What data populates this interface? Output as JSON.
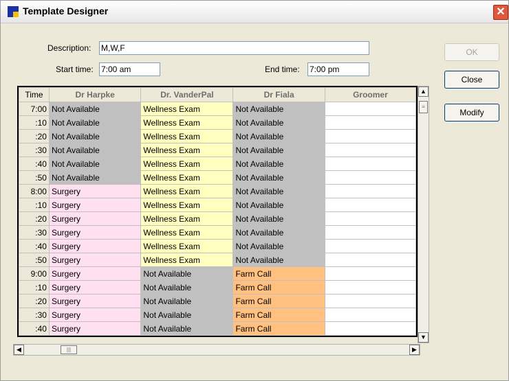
{
  "window": {
    "title": "Template Designer"
  },
  "form": {
    "description_label": "Description:",
    "description_value": "M,W,F",
    "start_label": "Start time:",
    "start_value": "7:00 am",
    "end_label": "End time:",
    "end_value": "7:00 pm"
  },
  "buttons": {
    "ok": "OK",
    "close": "Close",
    "modify": "Modify"
  },
  "grid": {
    "headers": [
      "Time",
      "Dr Harpke",
      "Dr. VanderPal",
      "Dr Fiala",
      "Groomer"
    ],
    "rows": [
      {
        "time": "7:00",
        "harpke": "Not Available",
        "vanderpal": "Wellness Exam",
        "fiala": "Not Available",
        "groomer": ""
      },
      {
        "time": ":10",
        "harpke": "Not Available",
        "vanderpal": "Wellness Exam",
        "fiala": "Not Available",
        "groomer": ""
      },
      {
        "time": ":20",
        "harpke": "Not Available",
        "vanderpal": "Wellness Exam",
        "fiala": "Not Available",
        "groomer": ""
      },
      {
        "time": ":30",
        "harpke": "Not Available",
        "vanderpal": "Wellness Exam",
        "fiala": "Not Available",
        "groomer": ""
      },
      {
        "time": ":40",
        "harpke": "Not Available",
        "vanderpal": "Wellness Exam",
        "fiala": "Not Available",
        "groomer": ""
      },
      {
        "time": ":50",
        "harpke": "Not Available",
        "vanderpal": "Wellness Exam",
        "fiala": "Not Available",
        "groomer": ""
      },
      {
        "time": "8:00",
        "harpke": "Surgery",
        "vanderpal": "Wellness Exam",
        "fiala": "Not Available",
        "groomer": ""
      },
      {
        "time": ":10",
        "harpke": "Surgery",
        "vanderpal": "Wellness Exam",
        "fiala": "Not Available",
        "groomer": ""
      },
      {
        "time": ":20",
        "harpke": "Surgery",
        "vanderpal": "Wellness Exam",
        "fiala": "Not Available",
        "groomer": ""
      },
      {
        "time": ":30",
        "harpke": "Surgery",
        "vanderpal": "Wellness Exam",
        "fiala": "Not Available",
        "groomer": ""
      },
      {
        "time": ":40",
        "harpke": "Surgery",
        "vanderpal": "Wellness Exam",
        "fiala": "Not Available",
        "groomer": ""
      },
      {
        "time": ":50",
        "harpke": "Surgery",
        "vanderpal": "Wellness Exam",
        "fiala": "Not Available",
        "groomer": ""
      },
      {
        "time": "9:00",
        "harpke": "Surgery",
        "vanderpal": "Not Available",
        "fiala": "Farm Call",
        "groomer": ""
      },
      {
        "time": ":10",
        "harpke": "Surgery",
        "vanderpal": "Not Available",
        "fiala": "Farm Call",
        "groomer": ""
      },
      {
        "time": ":20",
        "harpke": "Surgery",
        "vanderpal": "Not Available",
        "fiala": "Farm Call",
        "groomer": ""
      },
      {
        "time": ":30",
        "harpke": "Surgery",
        "vanderpal": "Not Available",
        "fiala": "Farm Call",
        "groomer": ""
      },
      {
        "time": ":40",
        "harpke": "Surgery",
        "vanderpal": "Not Available",
        "fiala": "Farm Call",
        "groomer": ""
      }
    ]
  },
  "colors": {
    "Not Available": "#c0c0c0",
    "Wellness Exam": "#ffffc0",
    "Surgery": "#ffe0f0",
    "Farm Call": "#ffc080"
  },
  "icons": {
    "app": "template-designer-icon",
    "close": "close-icon"
  }
}
